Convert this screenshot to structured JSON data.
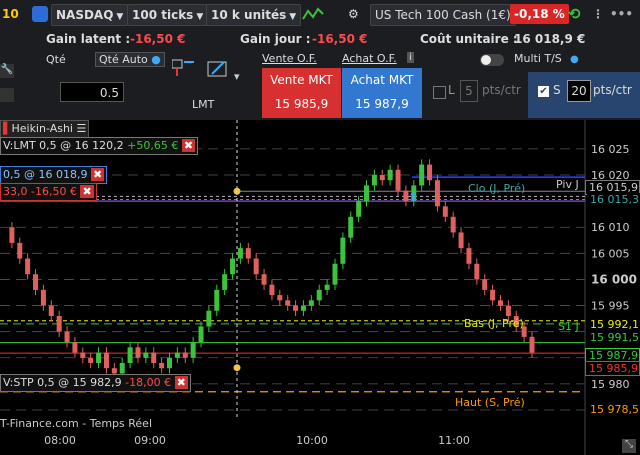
{
  "toolbar": {
    "counter": "10",
    "symbol": "NASDAQ",
    "ticks": "100 ticks",
    "units": "10 k unités",
    "instrument": "US Tech 100 Cash (1€)",
    "change": "-0,18 %"
  },
  "stats": {
    "gain_latent_label": "Gain latent :",
    "gain_latent_value": "-16,50 €",
    "gain_jour_label": "Gain jour :",
    "gain_jour_value": "-16,50 €",
    "cout_label": "Coût unitaire :",
    "cout_value": "16 018,9 €"
  },
  "order_panel": {
    "qty_label": "Qté",
    "qty_auto_label": "Qté Auto",
    "qty_value": "0.5",
    "lmt_label": "LMT",
    "vente_of_label": "Vente O.F.",
    "achat_of_label": "Achat O.F.",
    "sell_label": "Vente MKT",
    "sell_price": "15 985,9",
    "buy_label": "Achat MKT",
    "buy_price": "15 987,9",
    "multi_ts_label": "Multi T/S",
    "l_label": "L",
    "l_value": "5",
    "l_unit": "pts/ctr",
    "s_label": "S",
    "s_value": "20",
    "s_unit": "pts/ctr"
  },
  "chart": {
    "type_label": "Heikin-Ashi",
    "order_lmt": "V:LMT 0,5 @ 16 120,2",
    "order_lmt_pnl": "+50,65 €",
    "position_label": "0,5 @ 16 018,9",
    "position_left": "33,0",
    "position_pnl": "-16,50 €",
    "order_stp": "V:STP 0,5 @ 15 982,9",
    "order_stp_pnl": "-18,00 €",
    "level_clo": "Clo (J, Pré)",
    "level_piv": "Piv J",
    "level_bas": "Bas (J, Pré)",
    "level_s1": "S1 J",
    "level_haut": "Haut (S, Pré)",
    "footer": "T-Finance.com - Temps Réel",
    "price_tags": [
      "15 992,1",
      "15 991,5",
      "15 987,9",
      "15 985,9",
      "15 978,5",
      "16 015,9",
      "16 015,3"
    ]
  },
  "chart_data": {
    "type": "line",
    "title": "",
    "xlabel": "",
    "ylabel": "",
    "x_ticks": [
      "08:00",
      "09:00",
      "10:00",
      "11:00"
    ],
    "y_ticks": [
      16025,
      16020,
      16015,
      16010,
      16005,
      16000,
      15995,
      15990,
      15985,
      15980,
      15975
    ],
    "y_tick_labels": [
      "16 025",
      "16 020",
      "16 015",
      "16 010",
      "16 005",
      "16 000",
      "15 995",
      "15 990",
      "15 985",
      "15 980",
      "15 975"
    ],
    "ylim": [
      15975,
      16029
    ],
    "series": [
      {
        "values": [
          16010,
          16007,
          16004,
          16001,
          15998,
          15995,
          15993,
          15990,
          15988,
          15986,
          15985,
          15984,
          15986,
          15983,
          15982,
          15984,
          15987,
          15985,
          15986,
          15984,
          15983,
          15985,
          15986,
          15985,
          15988,
          15991,
          15994,
          15998,
          16001,
          16004,
          16006,
          16004,
          16001,
          15999,
          15997,
          15996,
          15995,
          15994,
          15995,
          15996,
          15998,
          15999,
          16003,
          16008,
          16012,
          16015,
          16018,
          16020,
          16019,
          16021,
          16017,
          16015,
          16018,
          16022,
          16019,
          16014,
          16012,
          16009,
          16006,
          16003,
          16000,
          15998,
          15996,
          15995,
          15993,
          15991,
          15989,
          15986
        ]
      }
    ],
    "colors": {
      "up": "#3cc23c",
      "down": "#e06060"
    }
  }
}
